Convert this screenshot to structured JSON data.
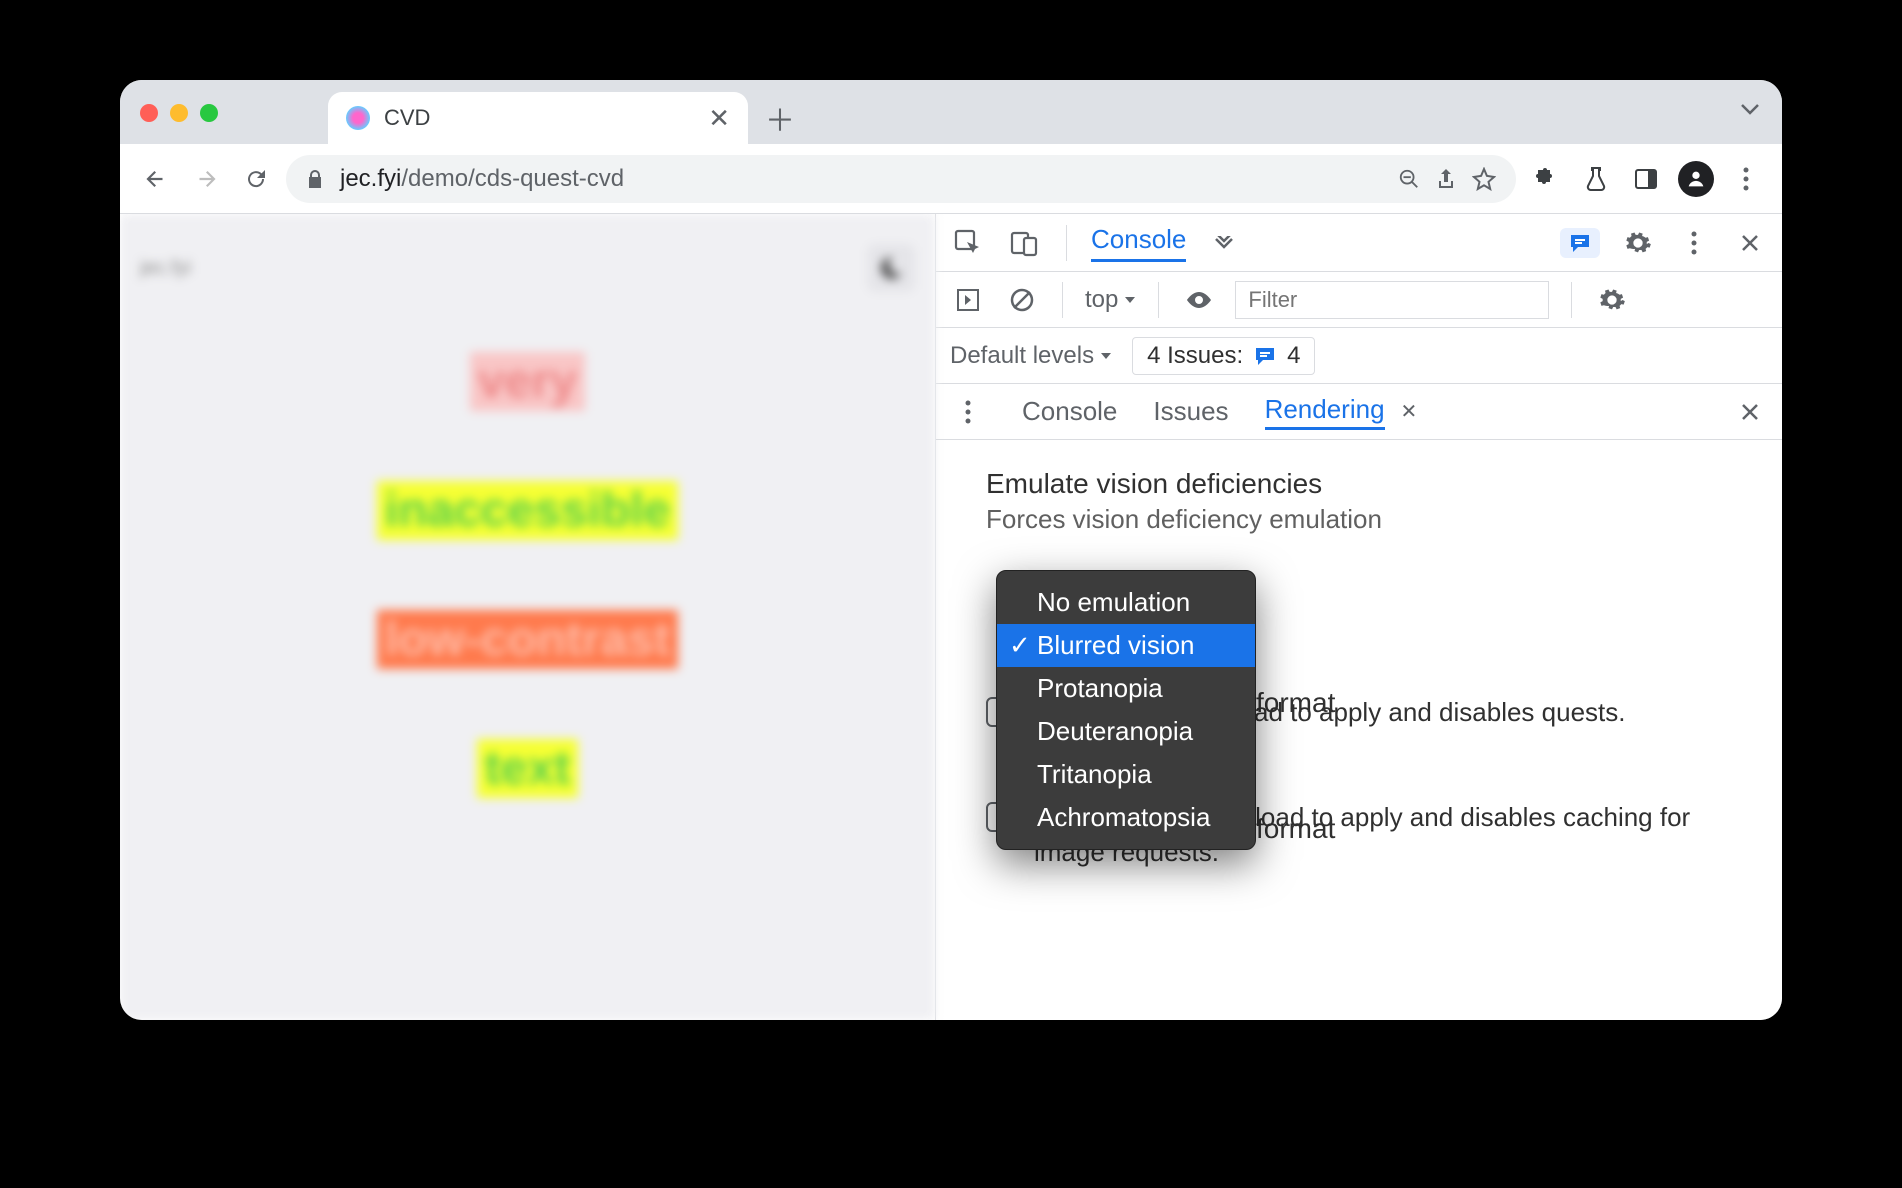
{
  "tab": {
    "title": "CVD"
  },
  "url": {
    "host": "jec.fyi",
    "path": "/demo/cds-quest-cvd"
  },
  "page": {
    "site_label": "jec.fyi",
    "words": [
      "very",
      "inaccessible",
      "low-contrast",
      "text"
    ]
  },
  "devtools": {
    "main_tab": "Console",
    "context": "top",
    "filter_placeholder": "Filter",
    "levels_label": "Default levels",
    "issues_label": "4 Issues:",
    "issues_count": "4",
    "drawer_tabs": {
      "console": "Console",
      "issues": "Issues",
      "rendering": "Rendering"
    },
    "rendering": {
      "title": "Emulate vision deficiencies",
      "subtitle": "Forces vision deficiency emulation",
      "options": [
        "No emulation",
        "Blurred vision",
        "Protanopia",
        "Deuteranopia",
        "Tritanopia",
        "Achromatopsia"
      ],
      "selected": "Blurred vision",
      "section2_title_visible": "format",
      "section2_body": "ad to apply and disables quests.",
      "section3_title_visible": "format",
      "section3_body": "Requires a page reload to apply and disables caching for image requests."
    }
  }
}
